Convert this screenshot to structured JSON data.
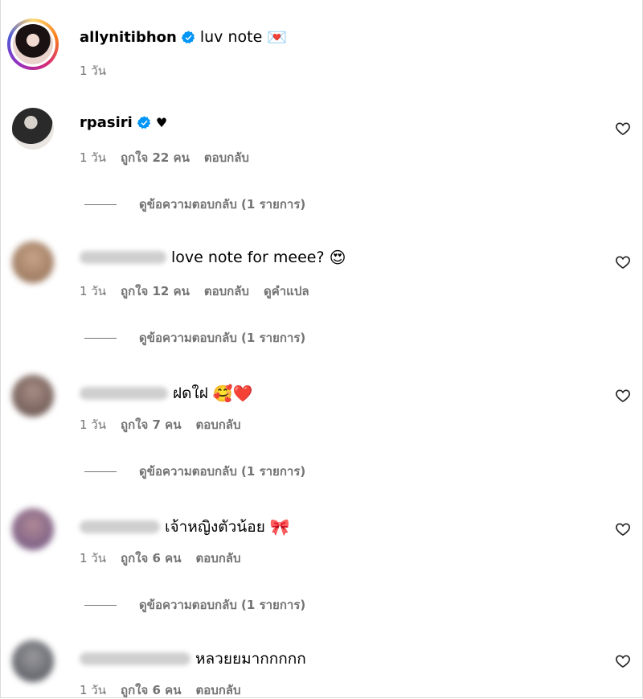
{
  "caption": {
    "username": "allynitibhon",
    "text": "luv note",
    "emoji": "💌",
    "time": "1 วัน"
  },
  "comments": [
    {
      "username": "rpasiri",
      "verified": true,
      "text": "♥",
      "time": "1 วัน",
      "likes": "ถูกใจ 22 คน",
      "reply": "ตอบกลับ",
      "view_replies": "ดูข้อความตอบกลับ (1 รายการ)"
    },
    {
      "username": "",
      "text": "love note for meee?",
      "emoji": "😍",
      "time": "1 วัน",
      "likes": "ถูกใจ 12 คน",
      "reply": "ตอบกลับ",
      "translate": "ดูคำแปล",
      "view_replies": "ดูข้อความตอบกลับ (1 รายการ)"
    },
    {
      "username": "",
      "text": "ฝดใฝ",
      "emoji": "🥰❤️",
      "time": "1 วัน",
      "likes": "ถูกใจ 7 คน",
      "reply": "ตอบกลับ",
      "view_replies": "ดูข้อความตอบกลับ (1 รายการ)"
    },
    {
      "username": "",
      "text": "เจ้าหญิงตัวน้อย",
      "emoji": "🎀",
      "time": "1 วัน",
      "likes": "ถูกใจ 6 คน",
      "reply": "ตอบกลับ",
      "view_replies": "ดูข้อความตอบกลับ (1 รายการ)"
    },
    {
      "username": "",
      "text": "หลวยยมากกกกก",
      "time": "1 วัน",
      "likes": "ถูกใจ 6 คน",
      "reply": "ตอบกลับ"
    }
  ],
  "icons": {
    "verified": "verified-badge-icon",
    "like": "heart-outline-icon"
  },
  "colors": {
    "verified_blue": "#0095f6",
    "meta_gray": "#737373"
  }
}
